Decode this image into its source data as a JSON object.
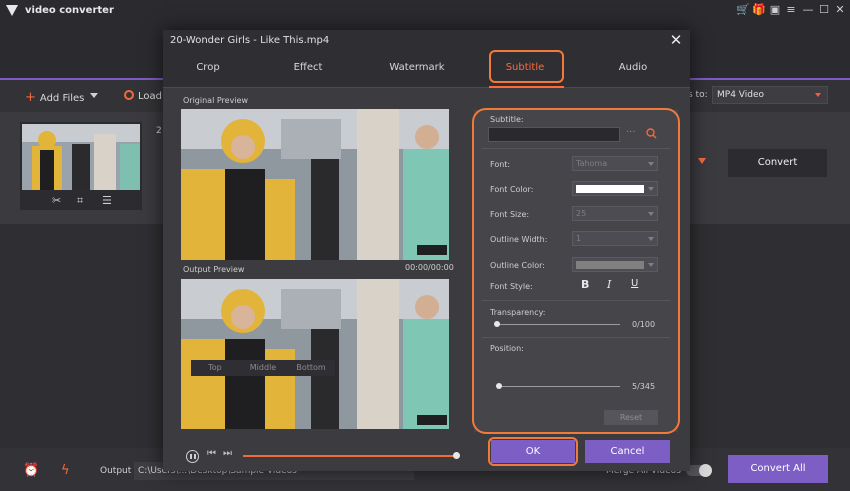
{
  "app": {
    "title": "video converter",
    "titlebar_icons": [
      "cart-icon",
      "gift-icon",
      "chat-icon",
      "menu-icon",
      "minimize-icon",
      "maximize-icon",
      "close-icon"
    ]
  },
  "toolbar": {
    "add_files_label": "Add Files",
    "load_label": "Load",
    "convert_to_label": "s to:",
    "format_value": "MP4 Video"
  },
  "file_list": {
    "item_number": "2",
    "convert_label": "Convert"
  },
  "bottom_bar": {
    "output_label": "Output",
    "output_path": "C:\\Users\\...\\Desktop\\Sample Videos",
    "merge_label": "Merge All Videos",
    "convert_all_label": "Convert All"
  },
  "modal": {
    "title": "20-Wonder Girls - Like This.mp4",
    "tabs": [
      {
        "label": "Crop"
      },
      {
        "label": "Effect"
      },
      {
        "label": "Watermark"
      },
      {
        "label": "Subtitle"
      },
      {
        "label": "Audio"
      }
    ],
    "active_tab": "Subtitle",
    "original_preview_label": "Original Preview",
    "output_preview_label": "Output Preview",
    "time_display": "00:00/00:00",
    "ok_label": "OK",
    "cancel_label": "Cancel"
  },
  "subtitle_panel": {
    "subtitle_label": "Subtitle:",
    "subtitle_value": "",
    "more_glyph": "···",
    "font_label": "Font:",
    "font_value": "Tahoma",
    "font_color_label": "Font Color:",
    "font_color_value": "#ffffff",
    "font_size_label": "Font Size:",
    "font_size_value": "25",
    "outline_width_label": "Outline Width:",
    "outline_width_value": "1",
    "outline_color_label": "Outline Color:",
    "outline_color_value": "#808080",
    "font_style_label": "Font Style:",
    "bold_label": "B",
    "italic_label": "I",
    "underline_label": "U",
    "transparency_label": "Transparency:",
    "transparency_value": "0/100",
    "position_label": "Position:",
    "position_options": [
      "Top",
      "Middle",
      "Bottom"
    ],
    "position_value": "5/345",
    "reset_label": "Reset"
  },
  "colors": {
    "accent_orange": "#f06a3c",
    "accent_purple": "#7c5ec4"
  }
}
